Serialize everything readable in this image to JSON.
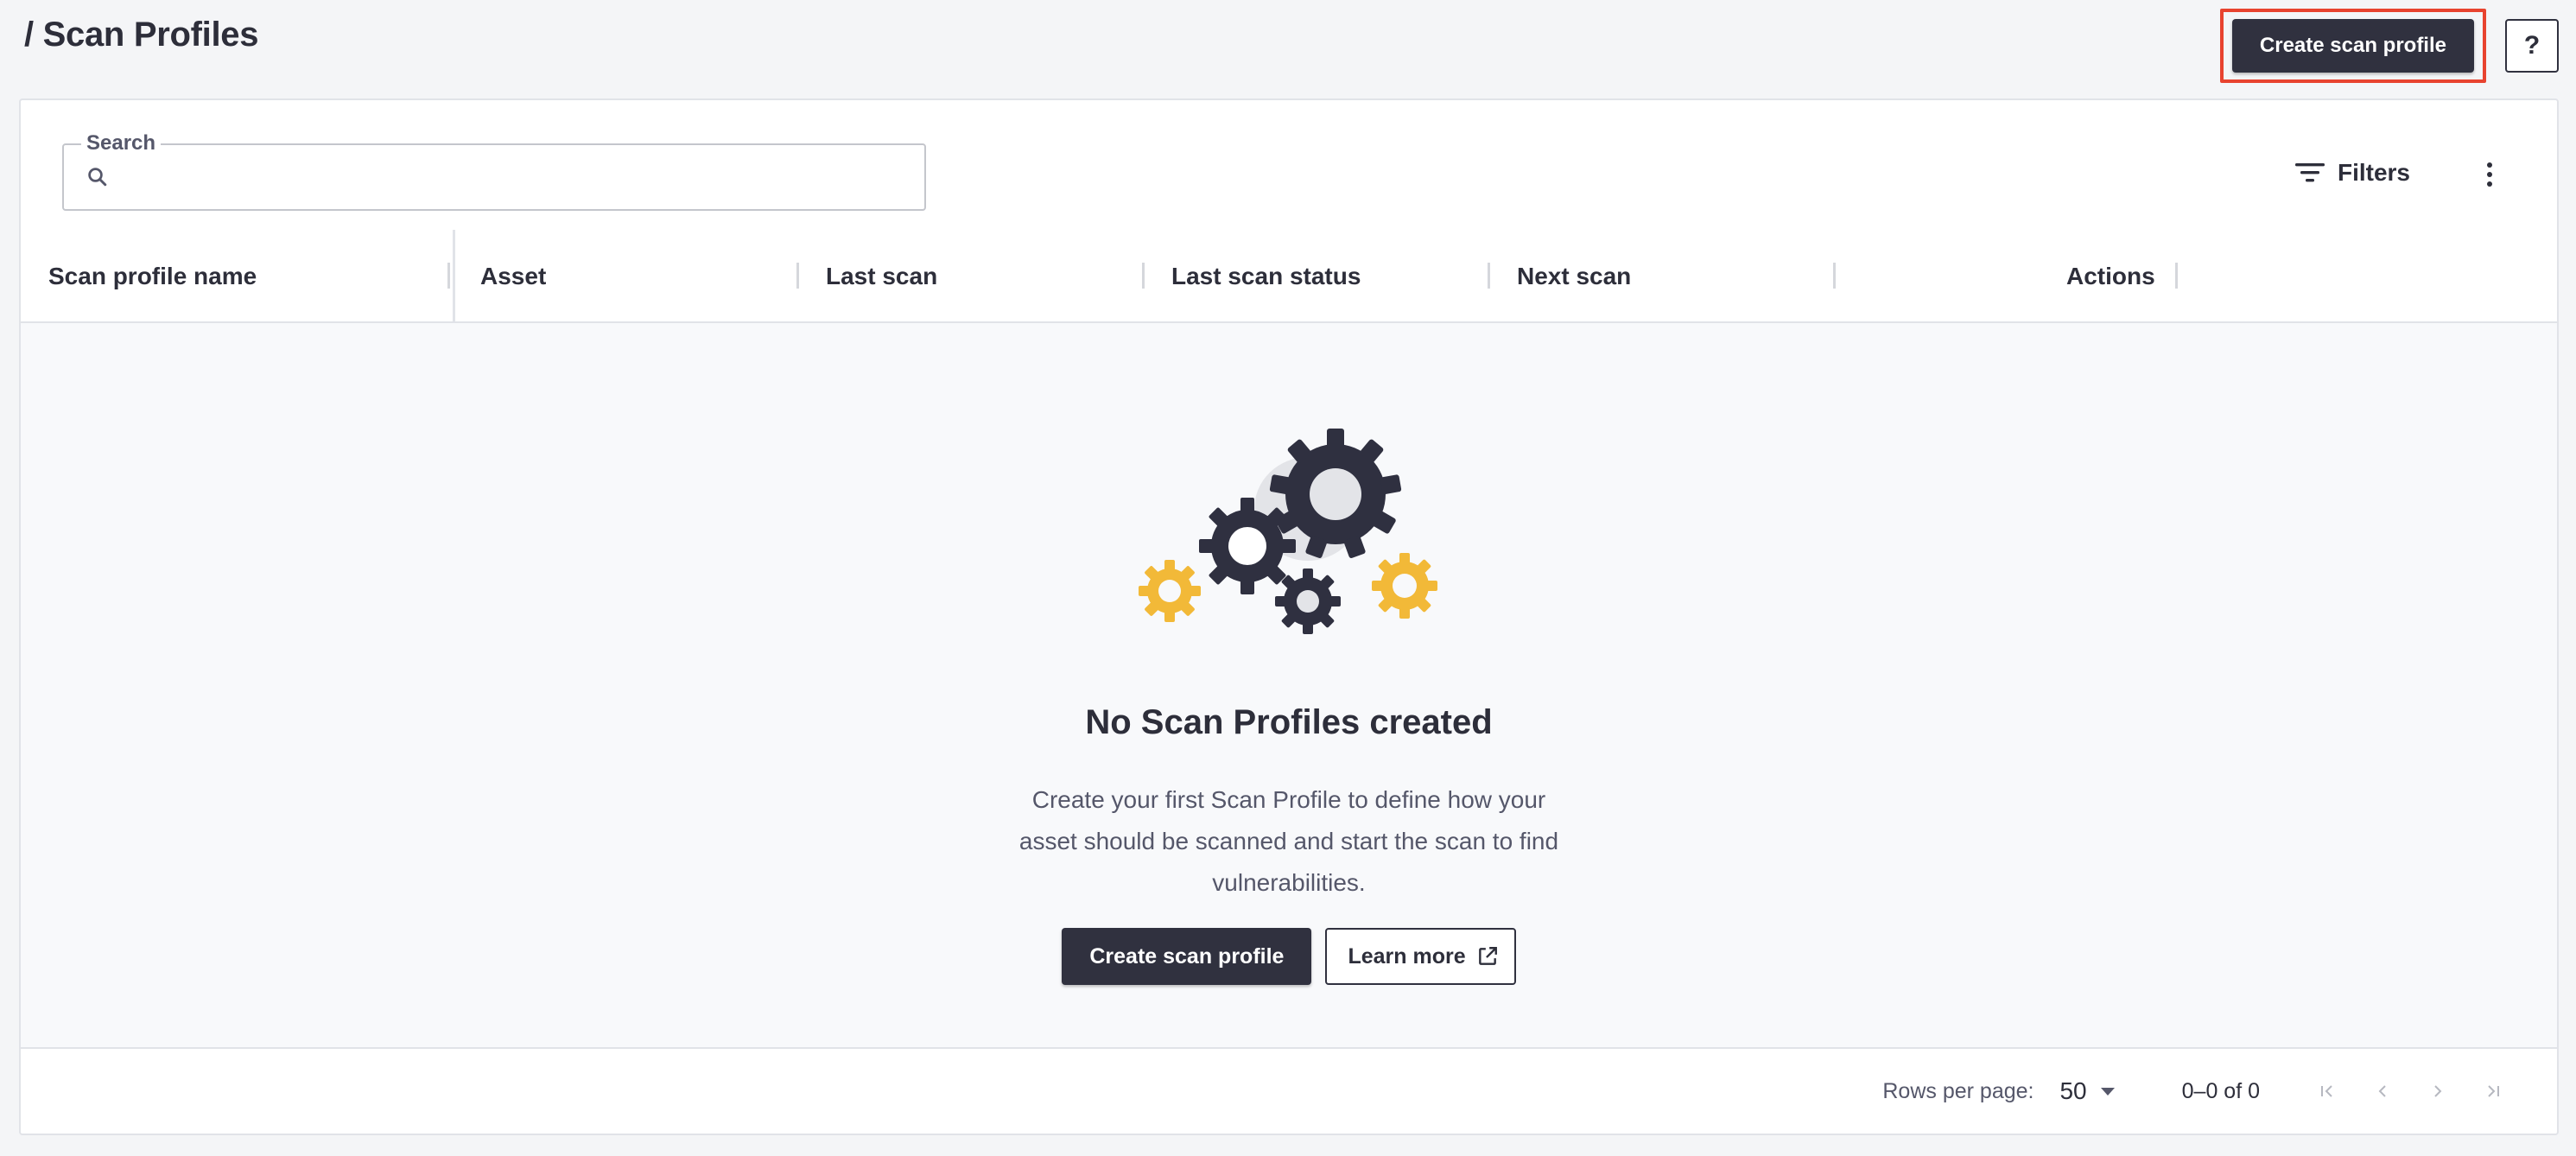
{
  "header": {
    "title": "/ Scan Profiles",
    "create_button": "Create scan profile",
    "help_button": "?"
  },
  "toolbar": {
    "search_label": "Search",
    "search_value": "",
    "filters_label": "Filters"
  },
  "table": {
    "columns": [
      "Scan profile name",
      "Asset",
      "Last scan",
      "Last scan status",
      "Next scan",
      "Actions"
    ]
  },
  "empty_state": {
    "title": "No Scan Profiles created",
    "description": "Create your first Scan Profile to define how your asset should be scanned and start the scan to find vulnerabilities.",
    "create_button": "Create scan profile",
    "learn_more_button": "Learn more"
  },
  "footer": {
    "rows_per_page_label": "Rows per page:",
    "rows_per_page_value": "50",
    "range_text": "0–0 of 0"
  },
  "icons": {
    "search": "search-icon",
    "filter": "filter-icon",
    "more": "kebab-icon",
    "external": "external-link-icon",
    "gears": "gears-illustration"
  },
  "colors": {
    "primary_dark": "#30313f",
    "highlight": "#e8432f",
    "gear_yellow": "#f2b938",
    "gear_dark": "#2f3040",
    "gear_light": "#e3e4e8"
  }
}
